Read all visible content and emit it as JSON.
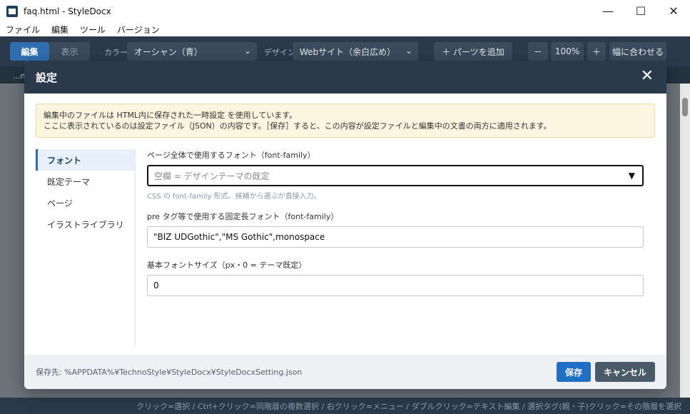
{
  "window": {
    "title": "faq.html - StyleDocx",
    "minimize": "—",
    "maximize": "☐",
    "close": "✕"
  },
  "menu": [
    "ファイル",
    "編集",
    "ツール",
    "バージョン"
  ],
  "toolbar": {
    "edit_label": "編集",
    "view_label": "表示",
    "color_label": "カラー",
    "color_value": "オーシャン（青）",
    "design_label": "デザイン",
    "design_value": "Webサイト（余白広め）",
    "add_parts_label": "＋ パーツを追加",
    "zoom_out": "－",
    "zoom_value": "100%",
    "zoom_in": "＋",
    "fit_width": "幅に合わせる"
  },
  "subbar_text": "...n",
  "statusbar": "クリック=選択 / Ctrl+クリック=同階層の複数選択 / 右クリック=メニュー / ダブルクリック=テキスト編集 / 選択タグ(親・子)クリック=その階層を選択",
  "dialog": {
    "title": "設定",
    "close_icon": "✕",
    "notice_line1": "編集中のファイルは HTML内に保存された一時設定 を使用しています。",
    "notice_line2": "ここに表示されているのは設定ファイル（JSON）の内容です。［保存］すると、この内容が設定ファイルと編集中の文書の両方に適用されます。",
    "nav": [
      "フォント",
      "既定テーマ",
      "ページ",
      "イラストライブラリ"
    ],
    "fields": {
      "page_font_label": "ページ全体で使用するフォント（font-family）",
      "page_font_placeholder": "空欄 = デザインテーマの既定",
      "page_font_hint": "CSS の font-family 形式。候補から選ぶか直接入力。",
      "mono_font_label": "pre タグ等で使用する固定長フォント（font-family）",
      "mono_font_value": "\"BIZ UDGothic\",\"MS Gothic\",monospace",
      "base_size_label": "基本フォントサイズ（px・0 = テーマ既定）",
      "base_size_value": "0"
    },
    "save_path": "保存先: %APPDATA%¥TechnoStyle¥StyleDocx¥StyleDocxSetting.json",
    "save_button": "保存",
    "cancel_button": "キャンセル"
  }
}
